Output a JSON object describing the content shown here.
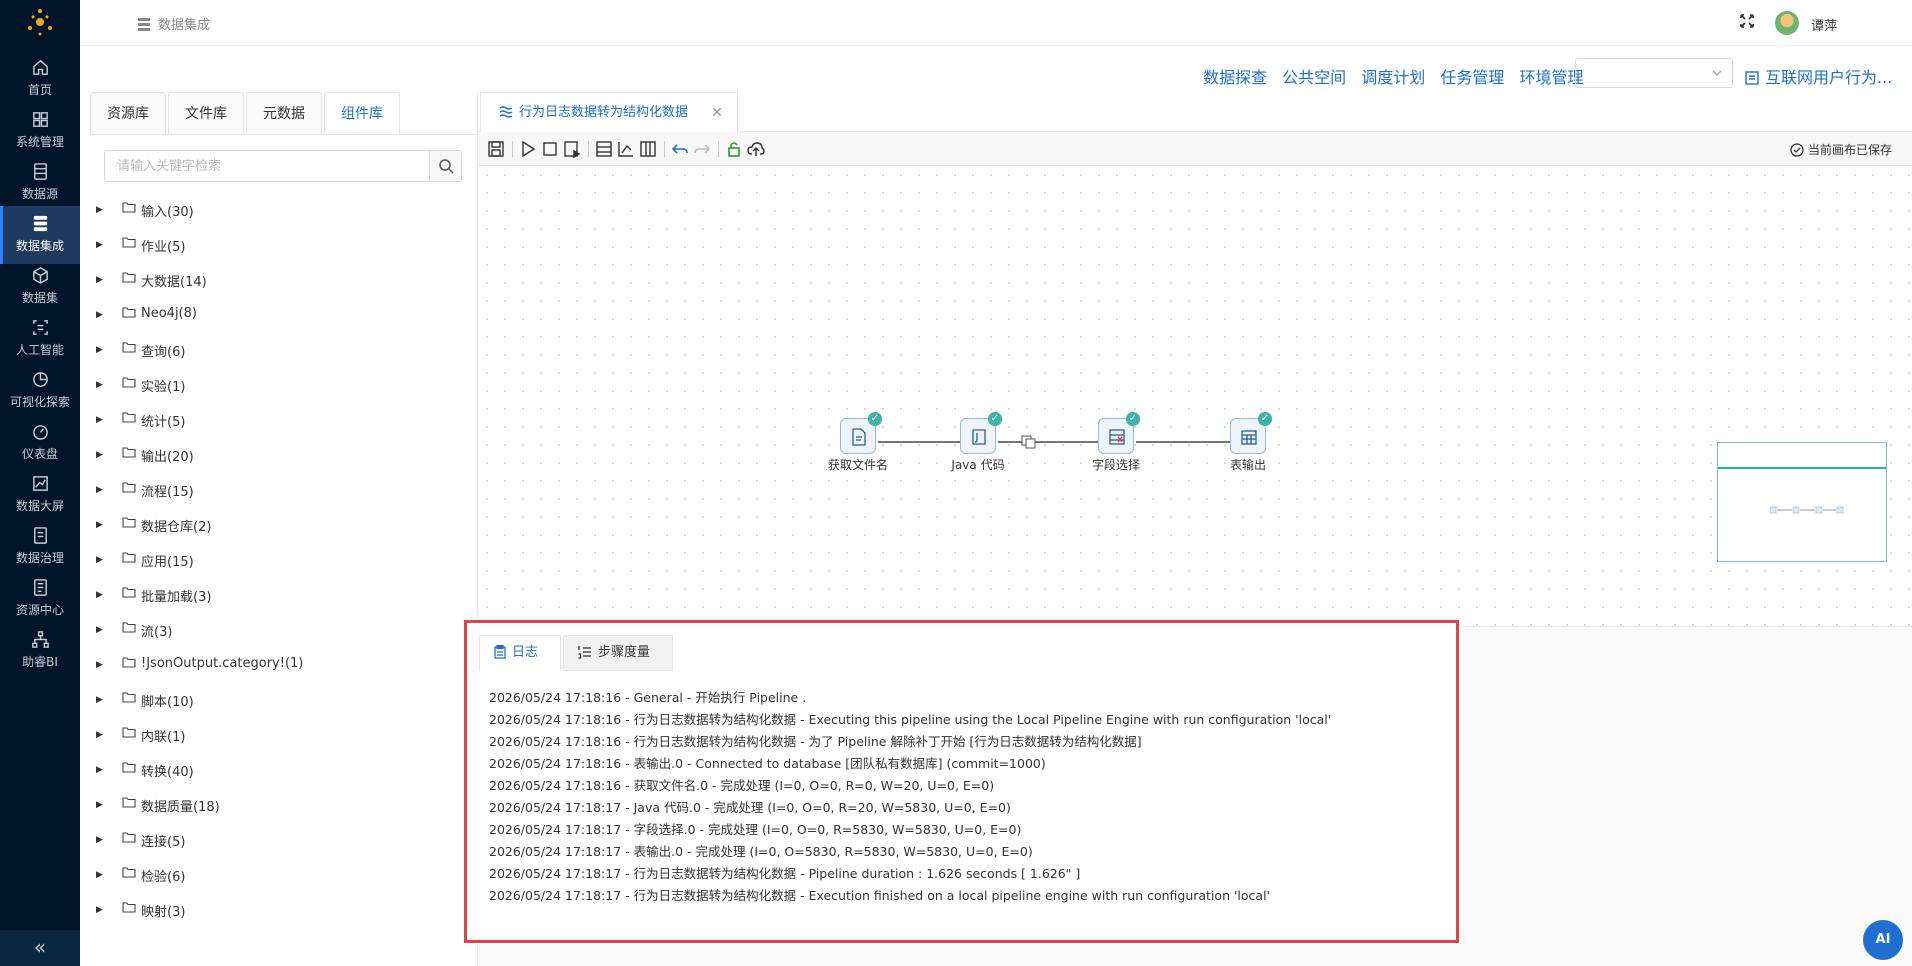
{
  "nav": {
    "items": [
      {
        "label": "首页",
        "icon": "home-icon"
      },
      {
        "label": "系统管理",
        "icon": "grid-icon"
      },
      {
        "label": "数据源",
        "icon": "database-icon"
      },
      {
        "label": "数据集成",
        "icon": "server-stack-icon"
      },
      {
        "label": "数据集",
        "icon": "cube-icon"
      },
      {
        "label": "人工智能",
        "icon": "ai-chip-icon"
      },
      {
        "label": "可视化探索",
        "icon": "pie-chart-icon"
      },
      {
        "label": "仪表盘",
        "icon": "gauge-icon"
      },
      {
        "label": "数据大屏",
        "icon": "line-chart-icon"
      },
      {
        "label": "数据治理",
        "icon": "document-list-icon"
      },
      {
        "label": "资源中心",
        "icon": "folder-doc-icon"
      },
      {
        "label": "助睿BI",
        "icon": "network-icon"
      }
    ],
    "active_index": 3,
    "collapse_glyph": "«"
  },
  "header": {
    "breadcrumb": "数据集成",
    "user_name": "谭萍"
  },
  "toplinks": [
    "数据探查",
    "公共空间",
    "调度计划",
    "任务管理",
    "环境管理"
  ],
  "env_select": {
    "value": ""
  },
  "tail_link": "互联网用户行为...",
  "library": {
    "tabs": [
      "资源库",
      "文件库",
      "元数据",
      "组件库"
    ],
    "active_tab": 3,
    "search_placeholder": "请输入关键字检索",
    "tree": [
      "输入(30)",
      "作业(5)",
      "大数据(14)",
      "Neo4j(8)",
      "查询(6)",
      "实验(1)",
      "统计(5)",
      "输出(20)",
      "流程(15)",
      "数据仓库(2)",
      "应用(15)",
      "批量加载(3)",
      "流(3)",
      "!JsonOutput.category!(1)",
      "脚本(10)",
      "内联(1)",
      "转换(40)",
      "数据质量(18)",
      "连接(5)",
      "检验(6)",
      "映射(3)"
    ]
  },
  "editor": {
    "tab_title": "行为日志数据转为结构化数据",
    "tab_close": "✕",
    "saved_status": "当前画布已保存",
    "steps": [
      {
        "name": "获取文件名"
      },
      {
        "name": "Java 代码"
      },
      {
        "name": "字段选择"
      },
      {
        "name": "表输出"
      }
    ]
  },
  "log": {
    "tabs": [
      "日志",
      "步骤度量"
    ],
    "active_tab": 0,
    "lines": [
      "2026/05/24 17:18:16 - General - 开始执行 Pipeline .",
      "2026/05/24 17:18:16 - 行为日志数据转为结构化数据 - Executing this pipeline using the Local Pipeline Engine with run configuration 'local'",
      "2026/05/24 17:18:16 - 行为日志数据转为结构化数据 - 为了 Pipeline 解除补丁开始 [行为日志数据转为结构化数据]",
      "2026/05/24 17:18:16 - 表输出.0 - Connected to database [团队私有数据库] (commit=1000)",
      "2026/05/24 17:18:16 - 获取文件名.0 - 完成处理 (I=0, O=0, R=0, W=20, U=0, E=0)",
      "2026/05/24 17:18:17 - Java 代码.0 - 完成处理 (I=0, O=0, R=20, W=5830, U=0, E=0)",
      "2026/05/24 17:18:17 - 字段选择.0 - 完成处理 (I=0, O=0, R=5830, W=5830, U=0, E=0)",
      "2026/05/24 17:18:17 - 表输出.0 - 完成处理 (I=0, O=5830, R=5830, W=5830, U=0, E=0)",
      "2026/05/24 17:18:17 - 行为日志数据转为结构化数据 - Pipeline duration : 1.626 seconds [  1.626\" ]",
      "2026/05/24 17:18:17 - 行为日志数据转为结构化数据 - Execution finished on a local pipeline engine with run configuration 'local'"
    ]
  },
  "ai_button": "AI",
  "colors": {
    "accent": "#1f6fd1",
    "nav_bg": "#001529",
    "highlight_border": "#e04545",
    "check": "#3db2a8"
  }
}
